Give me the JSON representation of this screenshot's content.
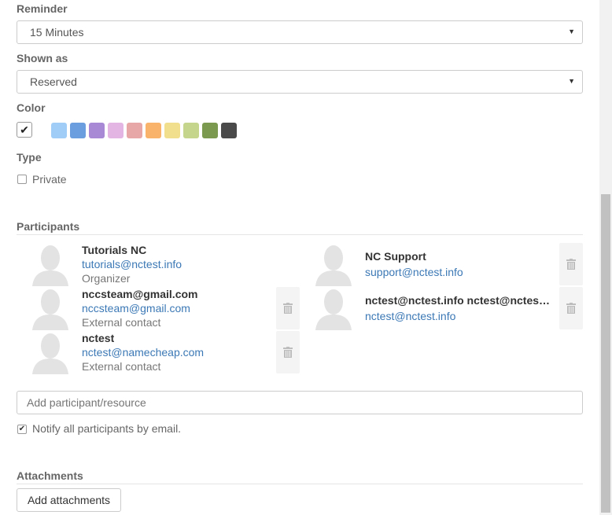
{
  "reminder": {
    "label": "Reminder",
    "value": "15 Minutes"
  },
  "shown_as": {
    "label": "Shown as",
    "value": "Reserved"
  },
  "color": {
    "label": "Color",
    "selected_check": "✔",
    "swatches": [
      "#9fcdf7",
      "#6b9ede",
      "#a889d5",
      "#e3b5e2",
      "#e7a7a7",
      "#f9b36a",
      "#f1df8d",
      "#c5d58c",
      "#7b9a4f",
      "#4a4a4a"
    ]
  },
  "type": {
    "label": "Type",
    "private_label": "Private"
  },
  "participants": {
    "label": "Participants",
    "items": [
      {
        "name": "Tutorials NC",
        "email": "tutorials@nctest.info",
        "role": "Organizer"
      },
      {
        "name": "NC Support",
        "email": "support@nctest.info",
        "role": ""
      },
      {
        "name": "nccsteam@gmail.com",
        "email": "nccsteam@gmail.com",
        "role": "External contact"
      },
      {
        "name": "nctest@nctest.info nctest@nctest.info",
        "email": "nctest@nctest.info",
        "role": ""
      },
      {
        "name": "nctest",
        "email": "nctest@namecheap.com",
        "role": "External contact"
      }
    ],
    "add_placeholder": "Add participant/resource",
    "notify_label": "Notify all participants by email."
  },
  "attachments": {
    "label": "Attachments",
    "add_button": "Add attachments"
  }
}
